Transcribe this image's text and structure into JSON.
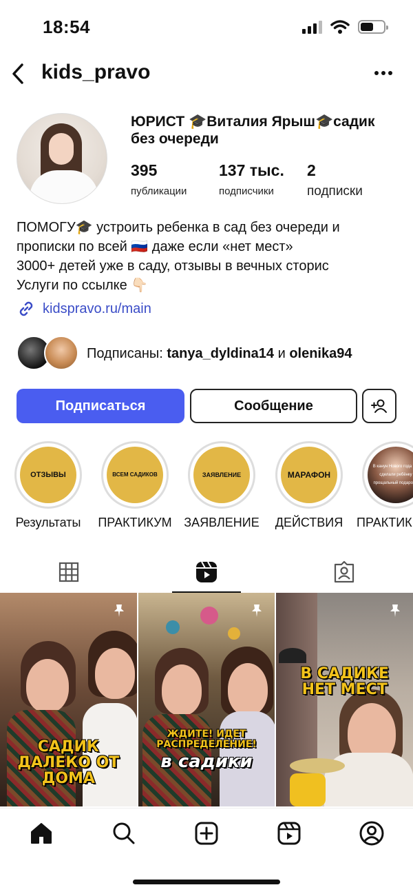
{
  "status": {
    "time": "18:54"
  },
  "header": {
    "username": "kids_pravo"
  },
  "profile": {
    "display_name": "ЮРИСТ 🎓Виталия Ярыш🎓садик без очереди",
    "stats": [
      {
        "value": "395",
        "label": "публикации"
      },
      {
        "value": "137 тыс.",
        "label": "подписчики"
      },
      {
        "value": "2",
        "label": "подписки"
      }
    ],
    "bio_lines": [
      "ПОМОГУ🎓 устроить ребенка в сад без очереди и",
      "прописки по всей 🇷🇺 даже если «нет мест»",
      "3000+ детей уже в саду, отзывы в вечных сторис",
      "Услуги по ссылке 👇🏻"
    ],
    "link": "kidspravo.ru/main",
    "followed_by_prefix": "Подписаны: ",
    "followed_by_user1": "tanya_dyldina14",
    "followed_by_and": " и ",
    "followed_by_user2": "olenika94"
  },
  "actions": {
    "follow": "Подписаться",
    "message": "Сообщение"
  },
  "highlights": [
    {
      "cover": "ОТЗЫВЫ",
      "label": "Результаты"
    },
    {
      "cover": "ВСЕМ САДИКОВ",
      "label": "ПРАКТИКУМ"
    },
    {
      "cover": "ЗАЯВЛЕНИЕ",
      "label": "ЗАЯВЛЕНИЕ"
    },
    {
      "cover": "МАРАФОН",
      "label": "ДЕЙСТВИЯ"
    },
    {
      "cover": "В канун Нового года мы сделали ребёнку прощальный подарок...",
      "label": "ПРАКТИК"
    }
  ],
  "grid": [
    {
      "caption": "САДИК ДАЛЕКО ОТ ДОМА"
    },
    {
      "caption_top": "ЖДИТЕ! ИДЕТ РАСПРЕДЕЛЕНИЕ!",
      "caption_bottom": "в садики"
    },
    {
      "caption": "В САДИКЕ НЕТ МЕСТ"
    }
  ],
  "icons": {
    "back": "chevron-left-icon",
    "more": "more-horizontal-icon",
    "link": "link-icon",
    "add_person": "add-person-icon",
    "grid": "grid-icon",
    "reels": "reels-icon",
    "tagged": "tagged-icon",
    "pin": "pin-icon",
    "home": "home-icon",
    "search": "search-icon",
    "create": "create-icon",
    "profile": "profile-icon"
  }
}
